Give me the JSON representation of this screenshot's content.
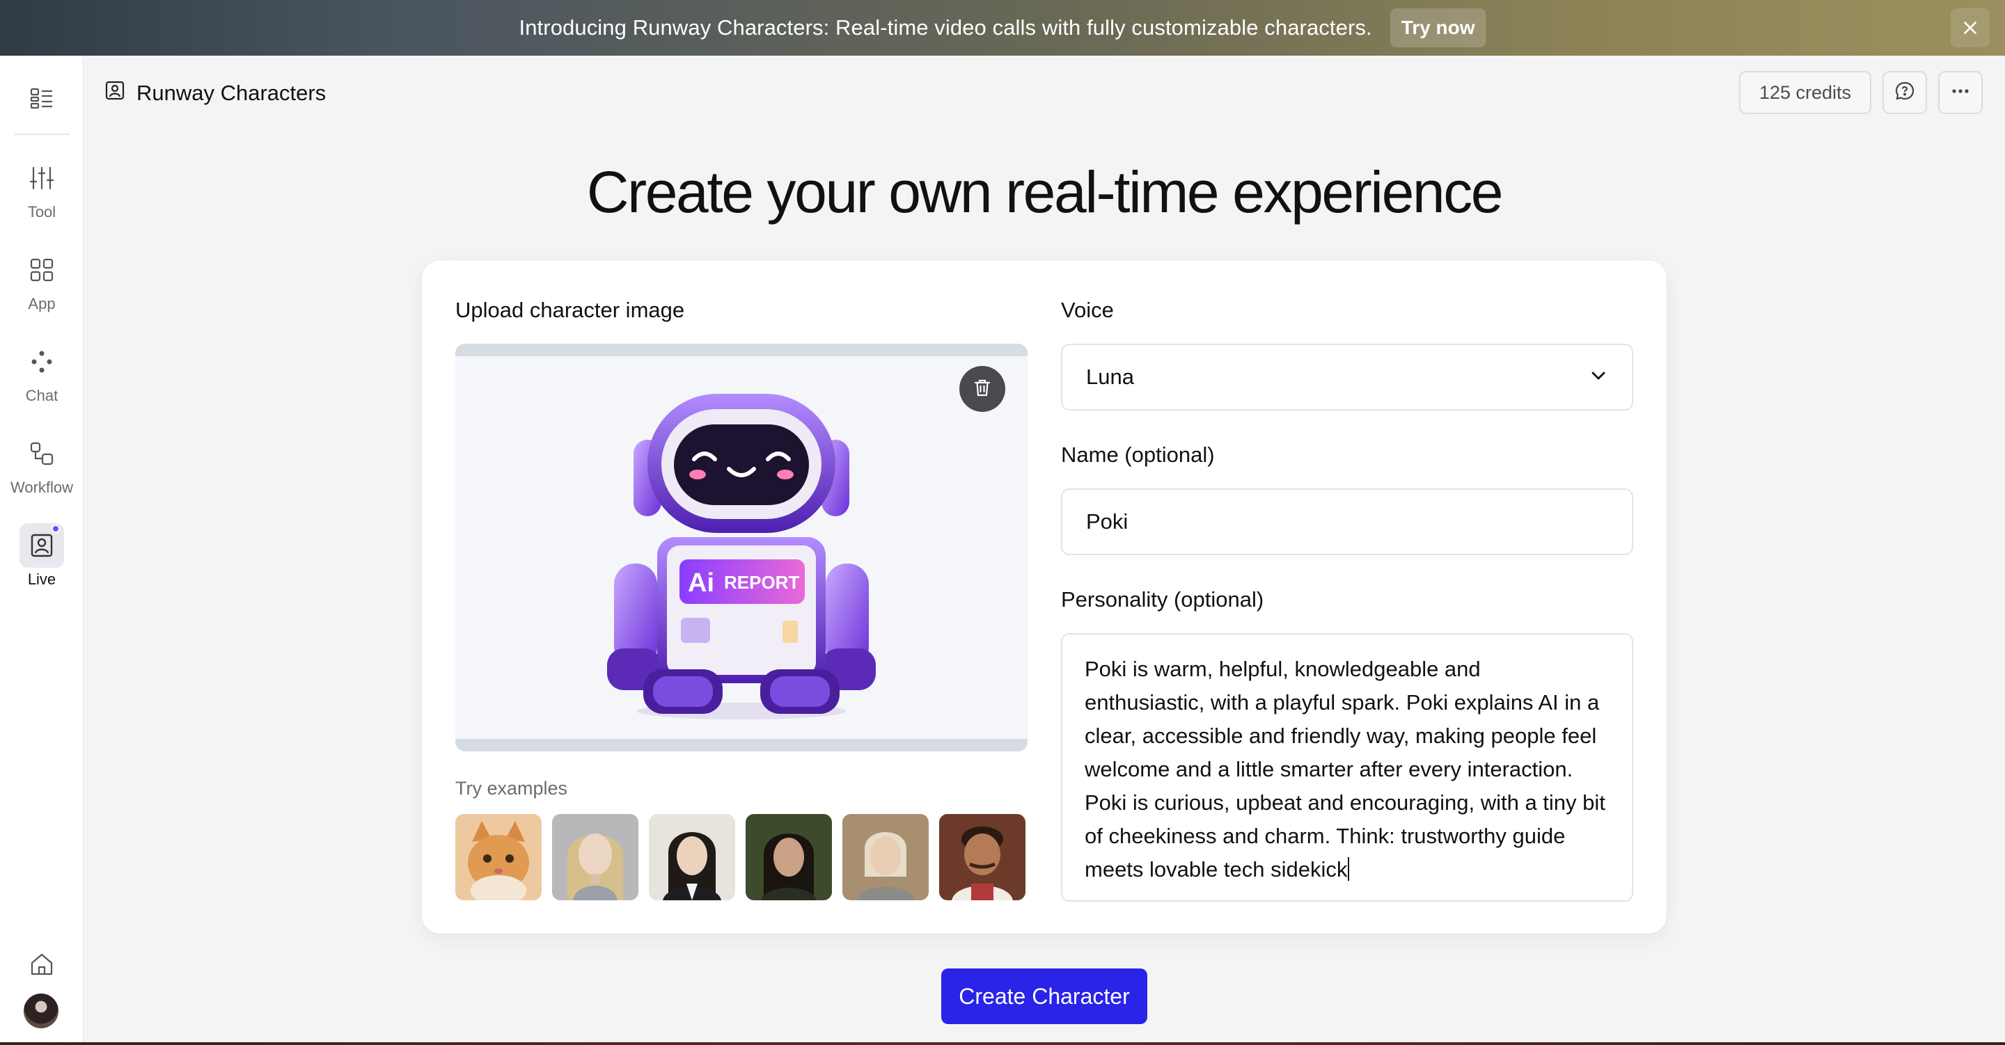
{
  "banner": {
    "text": "Introducing Runway Characters: Real-time video calls with fully customizable characters.",
    "cta": "Try now",
    "close_icon": "close-icon"
  },
  "sidebar": {
    "top_icon": "layout-list-icon",
    "items": [
      {
        "label": "Tool",
        "icon": "sliders-icon"
      },
      {
        "label": "App",
        "icon": "grid-icon"
      },
      {
        "label": "Chat",
        "icon": "dots-icon"
      },
      {
        "label": "Workflow",
        "icon": "workflow-icon"
      },
      {
        "label": "Live",
        "icon": "portrait-icon",
        "active": true
      }
    ],
    "home_icon": "home-icon"
  },
  "header": {
    "title": "Runway Characters",
    "credits": "125 credits"
  },
  "main": {
    "headline": "Create your own real-time experience"
  },
  "form": {
    "upload_label": "Upload character image",
    "robot_logo": {
      "mark": "Ai",
      "word": "REPORT"
    },
    "examples_label": "Try examples",
    "examples": [
      "cat",
      "android woman",
      "woman in blazer",
      "person in field",
      "blonde person",
      "cartoon chef"
    ],
    "voice_label": "Voice",
    "voice_value": "Luna",
    "name_label": "Name (optional)",
    "name_value": "Poki",
    "personality_label": "Personality (optional)",
    "personality_lines": [
      "Poki is warm, helpful, knowledgeable and",
      "enthusiastic, with a playful spark. Poki explains AI in a",
      "clear, accessible and friendly way, making people feel",
      "welcome and a little smarter after every interaction.",
      "Poki is curious, upbeat and encouraging, with a tiny bit",
      "of cheekiness and charm. Think: trustworthy guide",
      "meets lovable tech sidekick"
    ],
    "submit": "Create Character"
  },
  "colors": {
    "accent": "#2a23e8",
    "live_dot": "#6b4cff"
  }
}
